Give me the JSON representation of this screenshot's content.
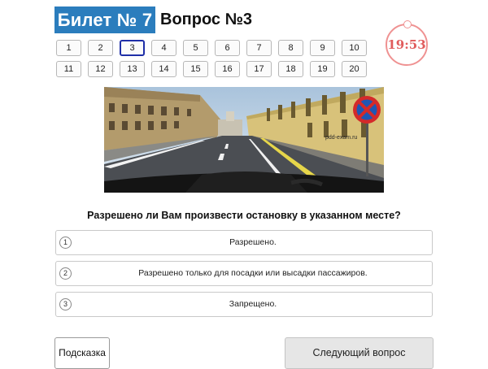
{
  "ticket": {
    "label": "Билет № 7"
  },
  "question_heading": "Вопрос №3",
  "timer": "19:53",
  "question_numbers": [
    "1",
    "2",
    "3",
    "4",
    "5",
    "6",
    "7",
    "8",
    "9",
    "10",
    "11",
    "12",
    "13",
    "14",
    "15",
    "16",
    "17",
    "18",
    "19",
    "20"
  ],
  "active_question": "3",
  "photo": {
    "watermark": "pdd-exam.ru"
  },
  "question_text": "Разрешено ли Вам произвести остановку в указанном месте?",
  "answers": [
    {
      "num": "1",
      "text": "Разрешено."
    },
    {
      "num": "2",
      "text": "Разрешено только для посадки или высадки пассажиров."
    },
    {
      "num": "3",
      "text": "Запрещено."
    }
  ],
  "buttons": {
    "hint": "Подсказка",
    "next": "Следующий вопрос"
  },
  "colors": {
    "accent": "#2b7dbd",
    "timer": "#e05c5c",
    "active_border": "#1f2fa8"
  }
}
